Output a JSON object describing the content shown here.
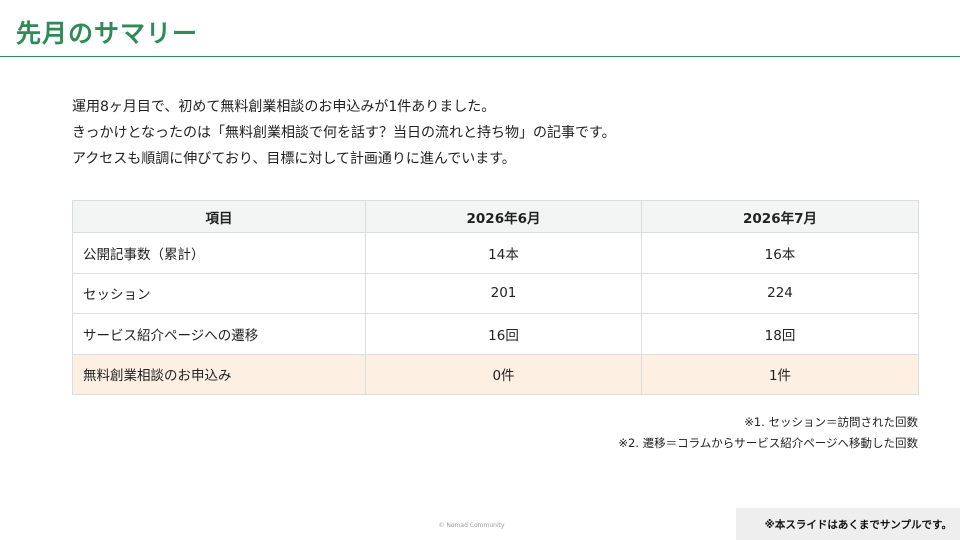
{
  "colors": {
    "accent": "#2e8b57",
    "highlight_row": "#fdf0e2"
  },
  "slide": {
    "title": "先月のサマリー",
    "intro": [
      "運用8ヶ月目で、初めて無料創業相談のお申込みが1件ありました。",
      "きっかけとなったのは「無料創業相談で何を話す？当日の流れと持ち物」の記事です。",
      "アクセスも順調に伸びており、目標に対して計画通りに進んでいます。"
    ]
  },
  "table": {
    "headers": [
      "項目",
      "2026年6月",
      "2026年7月"
    ],
    "rows": [
      {
        "label": "公開記事数（累計）",
        "jun": "14本",
        "jul": "16本"
      },
      {
        "label": "セッション",
        "jun": "201",
        "jul": "224"
      },
      {
        "label": "サービス紹介ページへの遷移",
        "jun": "16回",
        "jul": "18回"
      },
      {
        "label": "無料創業相談のお申込み",
        "jun": "0件",
        "jul": "1件"
      }
    ]
  },
  "notes": [
    "※1. セッション＝訪問された回数",
    "※2. 遷移＝コラムからサービス紹介ページへ移動した回数"
  ],
  "footer": {
    "copyright": "© Nomad Community",
    "disclaimer": "※本スライドはあくまでサンプルです。"
  }
}
